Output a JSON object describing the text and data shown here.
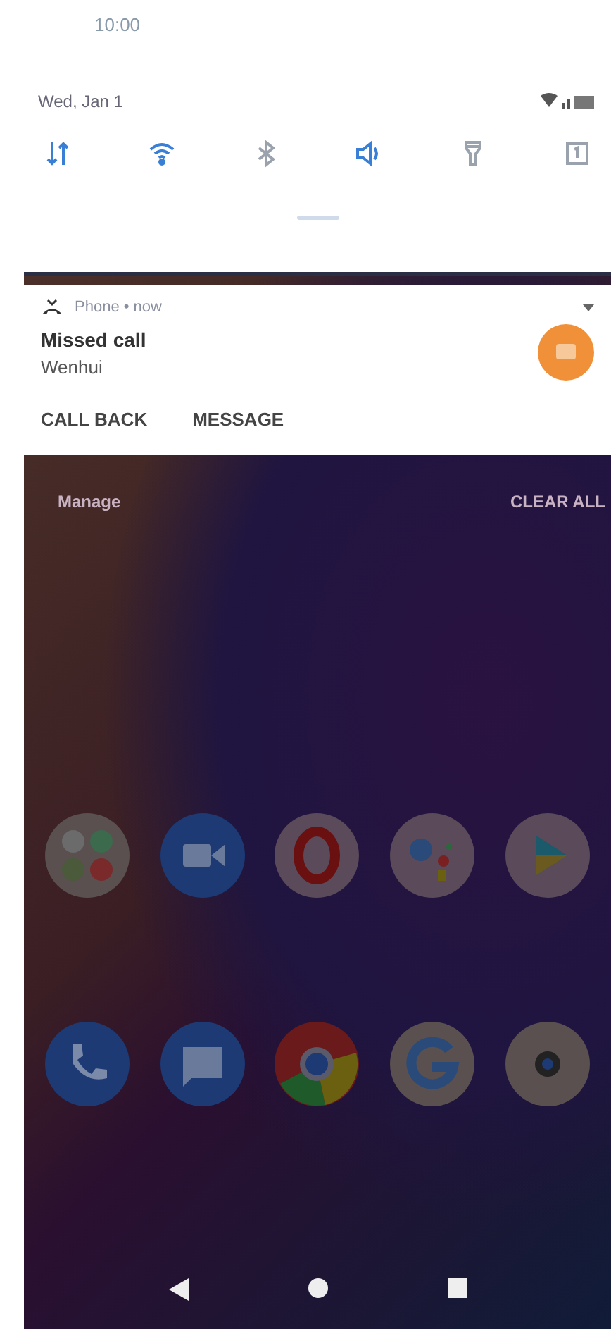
{
  "status_bar": {
    "time": "10:00",
    "date": "Wed, Jan 1"
  },
  "quick_settings": [
    {
      "kind": "data",
      "on": true
    },
    {
      "kind": "wifi",
      "on": true
    },
    {
      "kind": "bluetooth",
      "on": false
    },
    {
      "kind": "sound",
      "on": true
    },
    {
      "kind": "flashlight",
      "on": false
    },
    {
      "kind": "rotate",
      "on": false
    }
  ],
  "notification": {
    "app": "Phone • now",
    "title": "Missed call",
    "text": "Wenhui",
    "actions": [
      "CALL BACK",
      "MESSAGE"
    ]
  },
  "notification_footer": {
    "manage": "Manage",
    "clear_all": "CLEAR ALL"
  }
}
